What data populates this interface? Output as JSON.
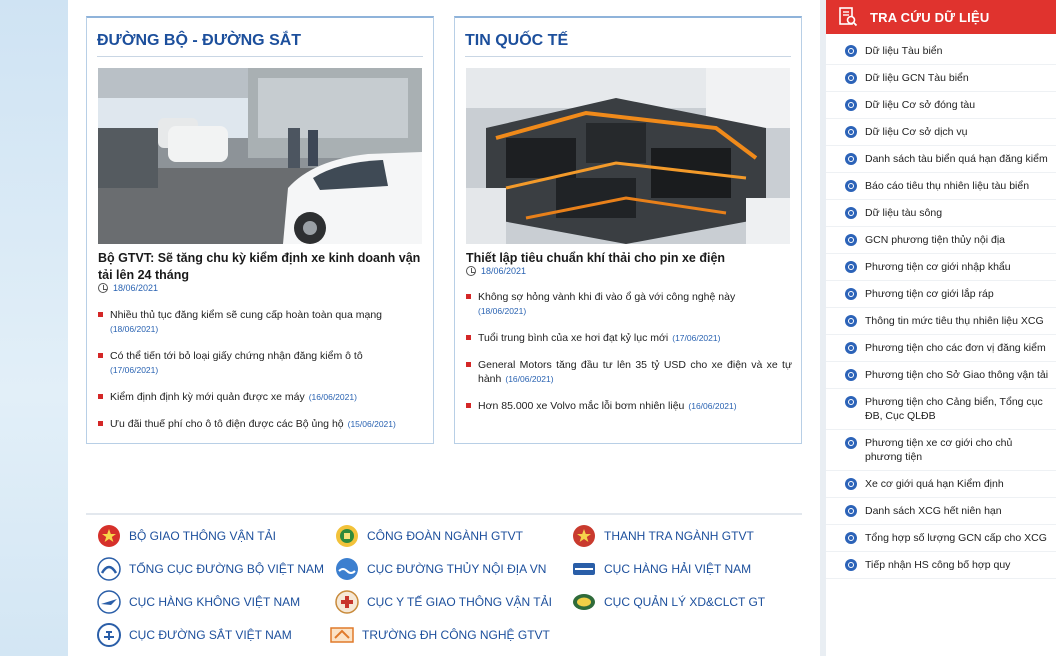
{
  "left_section": {
    "title": "ĐƯỜNG BỘ - ĐƯỜNG SẮT",
    "headline": "Bộ GTVT: Sẽ tăng chu kỳ kiểm định xe kinh doanh vận tải lên 24 tháng",
    "date": "18/06/2021",
    "items": [
      {
        "text": "Nhiều thủ tục đăng kiểm sẽ cung cấp hoàn toàn qua mạng",
        "date": "(18/06/2021)"
      },
      {
        "text": "Có thể tiến tới bỏ loại giấy chứng nhận đăng kiểm ô tô",
        "date": "(17/06/2021)"
      },
      {
        "text": "Kiểm định định kỳ mới quản được xe máy",
        "date": "(16/06/2021)"
      },
      {
        "text": "Ưu đãi thuế phí cho ô tô điện được các Bộ ủng hộ",
        "date": "(15/06/2021)"
      }
    ]
  },
  "right_section": {
    "title": "TIN QUỐC TẾ",
    "headline": "Thiết lập tiêu chuẩn khí thải cho pin xe điện",
    "date": "18/06/2021",
    "items": [
      {
        "text": "Không sợ hỏng vành khi đi vào ổ gà với công nghệ này",
        "date": "(18/06/2021)"
      },
      {
        "text": "Tuổi trung bình của xe hơi đạt kỷ lục mới",
        "date": "(17/06/2021)"
      },
      {
        "text": "General Motors tăng đầu tư lên 35 tỷ USD cho xe điện và xe tự hành",
        "date": "(16/06/2021)"
      },
      {
        "text": "Hơn 85.000 xe Volvo mắc lỗi bơm nhiên liệu",
        "date": "(16/06/2021)"
      }
    ]
  },
  "org_links": [
    {
      "label": "BỘ GIAO THÔNG VẬN TẢI",
      "icon": "emblem-icon"
    },
    {
      "label": "CÔNG ĐOÀN NGÀNH GTVT",
      "icon": "union-icon"
    },
    {
      "label": "THANH TRA NGÀNH GTVT",
      "icon": "inspection-icon"
    },
    {
      "label": "TỔNG CỤC ĐƯỜNG BỘ VIỆT NAM",
      "icon": "road-admin-icon"
    },
    {
      "label": "CỤC ĐƯỜNG THỦY NỘI ĐỊA VN",
      "icon": "waterway-icon"
    },
    {
      "label": "CỤC HÀNG HẢI VIỆT NAM",
      "icon": "maritime-icon"
    },
    {
      "label": "CỤC HÀNG KHÔNG VIỆT NAM",
      "icon": "aviation-icon"
    },
    {
      "label": "CỤC Y TẾ GIAO THÔNG VẬN TẢI",
      "icon": "health-icon"
    },
    {
      "label": "CỤC QUẢN LÝ XD&CLCT GT",
      "icon": "construction-icon"
    },
    {
      "label": "CỤC ĐƯỜNG SẮT VIỆT NAM",
      "icon": "railway-icon"
    },
    {
      "label": "TRƯỜNG ĐH CÔNG NGHỆ GTVT",
      "icon": "university-icon"
    }
  ],
  "sidebar": {
    "title": "TRA CỨU DỮ LIỆU",
    "items": [
      "Dữ liệu Tàu biển",
      "Dữ liệu GCN Tàu biển",
      "Dữ liệu Cơ sở đóng tàu",
      "Dữ liệu Cơ sở dịch vụ",
      "Danh sách tàu biển quá hạn đăng kiểm",
      "Báo cáo tiêu thụ nhiên liệu tàu biển",
      "Dữ liệu tàu sông",
      "GCN phương tiện thủy nội địa",
      "Phương tiện cơ giới nhập khẩu",
      "Phương tiện cơ giới lắp ráp",
      "Thông tin mức tiêu thụ nhiên liệu XCG",
      "Phương tiện cho các đơn vị đăng kiểm",
      "Phương tiện cho Sở Giao thông vận tải",
      "Phương tiện cho Cảng biển, Tổng cục ĐB, Cục QLĐB",
      "Phương tiện xe cơ giới cho chủ phương tiện",
      "Xe cơ giới quá hạn Kiểm định",
      "Danh sách XCG hết niên hạn",
      "Tổng hợp số lượng GCN cấp cho XCG",
      "Tiếp nhận HS công bố hợp quy"
    ]
  },
  "colors": {
    "accent_blue": "#1c4f9c",
    "date_blue": "#2a63b2",
    "bullet_red": "#d42727",
    "sidebar_header_red": "#e0332e"
  }
}
